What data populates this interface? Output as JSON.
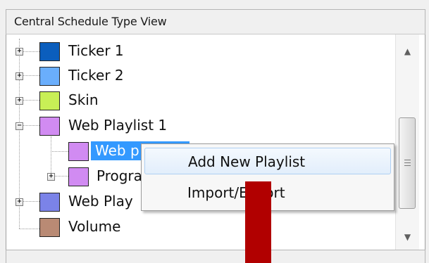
{
  "panel": {
    "title": "Central Schedule Type View"
  },
  "tree": {
    "items": [
      {
        "label": "Ticker 1",
        "color": "#0b5ebd",
        "expander": "+"
      },
      {
        "label": "Ticker 2",
        "color": "#6aaefc",
        "expander": "+"
      },
      {
        "label": "Skin",
        "color": "#c8ef56",
        "expander": "+"
      },
      {
        "label": "Web Playlist 1",
        "color": "#d18bf2",
        "expander": "−"
      },
      {
        "label": "Web p",
        "color": "#d18bf2",
        "expander": ""
      },
      {
        "label": "Progra",
        "color": "#d18bf2",
        "expander": "+"
      },
      {
        "label": "Web Play",
        "color": "#7b83e8",
        "expander": "+"
      },
      {
        "label": "Volume",
        "color": "#b98a74",
        "expander": ""
      }
    ]
  },
  "scrollbar": {
    "up_arrow": "▲",
    "down_arrow": "▼"
  },
  "context_menu": {
    "items": [
      {
        "label": "Add New Playlist"
      },
      {
        "label": "Import/Export"
      }
    ]
  },
  "colors": {
    "selection": "#3399ff",
    "overlay_block": "#b10000"
  }
}
